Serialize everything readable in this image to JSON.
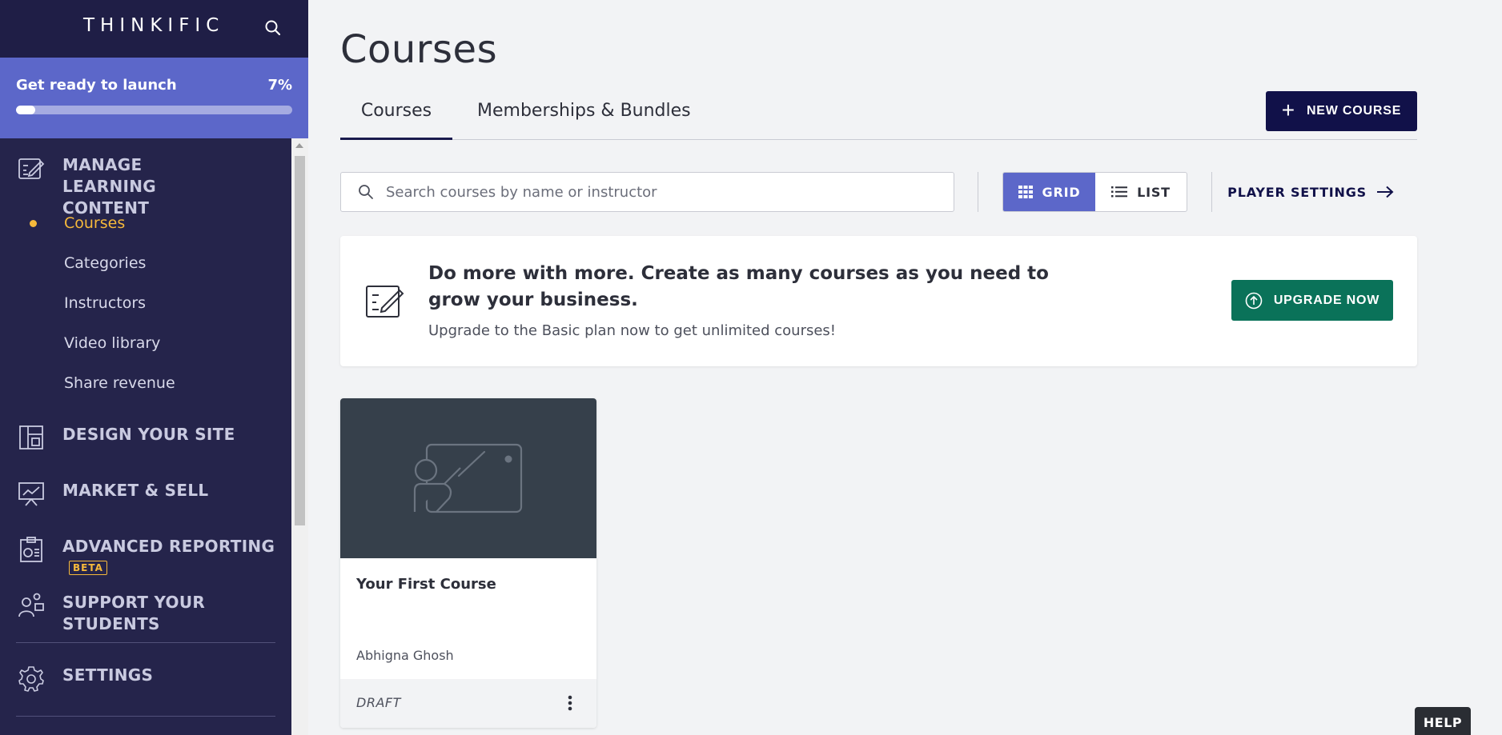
{
  "brand": {
    "name": "THINKIFIC"
  },
  "launch": {
    "label": "Get ready to launch",
    "percent_text": "7%",
    "progress_fraction": 0.07
  },
  "sidebar": {
    "manage": {
      "label": "MANAGE LEARNING CONTENT"
    },
    "manage_items": [
      "Courses",
      "Categories",
      "Instructors",
      "Video library",
      "Share revenue"
    ],
    "design": {
      "label": "DESIGN YOUR SITE"
    },
    "market": {
      "label": "MARKET & SELL"
    },
    "reporting": {
      "label": "ADVANCED REPORTING",
      "badge": "BETA"
    },
    "support": {
      "label": "SUPPORT YOUR STUDENTS"
    },
    "settings": {
      "label": "SETTINGS"
    }
  },
  "page": {
    "title": "Courses"
  },
  "tabs": [
    "Courses",
    "Memberships & Bundles"
  ],
  "toolbar": {
    "new_course": "NEW COURSE",
    "search_placeholder": "Search courses by name or instructor",
    "grid": "GRID",
    "list": "LIST",
    "player_settings": "PLAYER SETTINGS"
  },
  "banner": {
    "title": "Do more with more. Create as many courses as you need to grow your business.",
    "subtitle": "Upgrade to the Basic plan now to get unlimited courses!",
    "button": "UPGRADE NOW"
  },
  "course": {
    "title": "Your First Course",
    "author": "Abhigna Ghosh",
    "status": "DRAFT"
  },
  "help": {
    "label": "HELP"
  },
  "colors": {
    "sidebar": "#25244b",
    "accent": "#5c67c9",
    "primary": "#111149",
    "upgrade": "#0a7259",
    "active": "#f6b93b"
  }
}
